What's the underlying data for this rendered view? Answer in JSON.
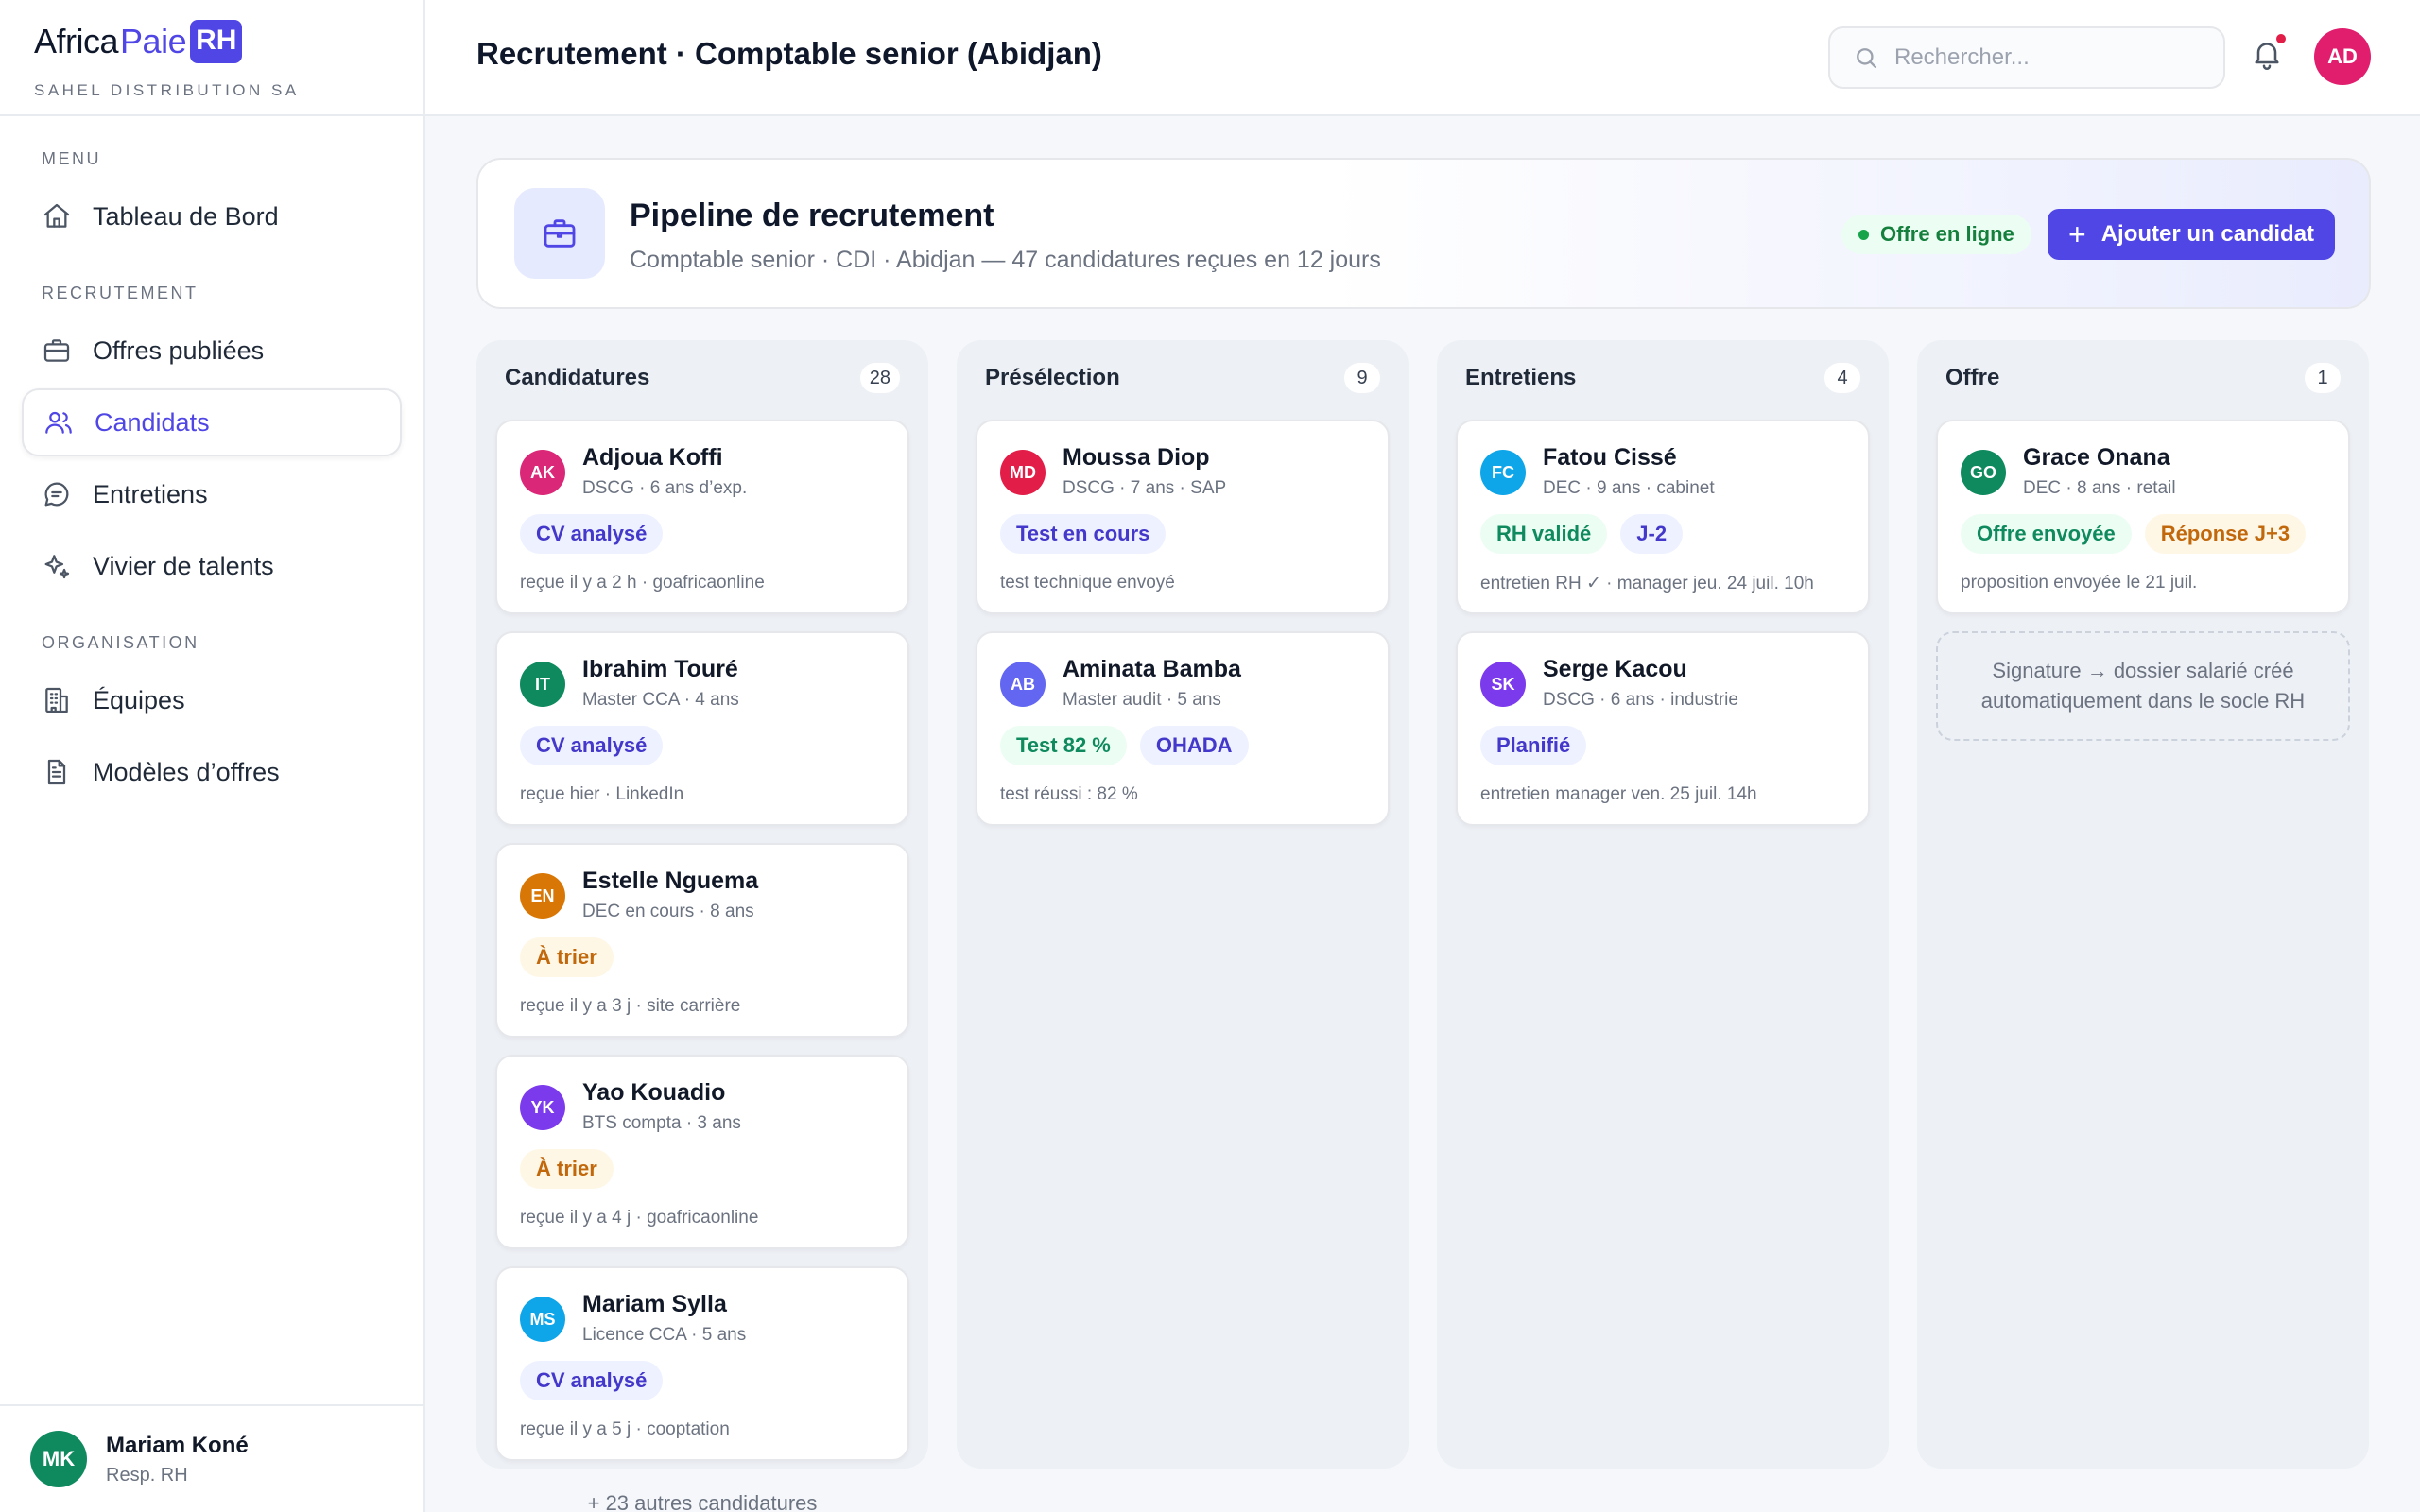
{
  "brand": {
    "name_part1": "Africa",
    "name_part2": "Paie",
    "name_part3": "RH",
    "company": "SAHEL DISTRIBUTION SA"
  },
  "nav": {
    "menu_label": "MENU",
    "dashboard": "Tableau de Bord",
    "recruitment_label": "RECRUTEMENT",
    "offers": "Offres publiées",
    "candidates": "Candidats",
    "interviews": "Entretiens",
    "talent_pool": "Vivier de talents",
    "organisation_label": "ORGANISATION",
    "teams": "Équipes",
    "offer_templates": "Modèles d’offres"
  },
  "user": {
    "initials": "MK",
    "name": "Mariam Koné",
    "role": "Resp. RH"
  },
  "header": {
    "title": "Recrutement · Comptable senior (Abidjan)",
    "search_placeholder": "Rechercher...",
    "avatar_initials": "AD"
  },
  "banner": {
    "title": "Pipeline de recrutement",
    "subtitle": "Comptable senior · CDI · Abidjan — 47 candidatures reçues en 12 jours",
    "status": "Offre en ligne",
    "add_button": "Ajouter un candidat"
  },
  "colors": {
    "accent": "#4f46e5",
    "green": "#0f8a5f",
    "amber": "#c2680c"
  },
  "columns": [
    {
      "title": "Candidatures",
      "count": "28",
      "more": "+ 23 autres candidatures",
      "cards": [
        {
          "initials": "AK",
          "color": "#db2777",
          "name": "Adjoua Koffi",
          "meta": "DSCG · 6 ans d’exp.",
          "tags": [
            "CV analysé"
          ],
          "foot": "reçue il y a 2 h · goafricaonline"
        },
        {
          "initials": "IT",
          "color": "#0f8a5f",
          "name": "Ibrahim Touré",
          "meta": "Master CCA · 4 ans",
          "tags": [
            "CV analysé"
          ],
          "foot": "reçue hier · LinkedIn"
        },
        {
          "initials": "EN",
          "color": "#d97706",
          "name": "Estelle Nguema",
          "meta": "DEC en cours · 8 ans",
          "tags": [
            "À trier"
          ],
          "foot": "reçue il y a 3 j · site carrière"
        },
        {
          "initials": "YK",
          "color": "#7c3aed",
          "name": "Yao Kouadio",
          "meta": "BTS compta · 3 ans",
          "tags": [
            "À trier"
          ],
          "foot": "reçue il y a 4 j · goafricaonline"
        },
        {
          "initials": "MS",
          "color": "#0ea5e9",
          "name": "Mariam Sylla",
          "meta": "Licence CCA · 5 ans",
          "tags": [
            "CV analysé"
          ],
          "foot": "reçue il y a 5 j · cooptation"
        }
      ]
    },
    {
      "title": "Présélection",
      "count": "9",
      "cards": [
        {
          "initials": "MD",
          "color": "#e11d48",
          "name": "Moussa Diop",
          "meta": "DSCG · 7 ans · SAP",
          "tags": [
            "Test en cours"
          ],
          "foot": "test technique envoyé"
        },
        {
          "initials": "AB",
          "color": "#6366f1",
          "name": "Aminata Bamba",
          "meta": "Master audit · 5 ans",
          "tags": [
            "Test 82 %",
            "OHADA"
          ],
          "foot": "test réussi : 82 %"
        }
      ]
    },
    {
      "title": "Entretiens",
      "count": "4",
      "cards": [
        {
          "initials": "FC",
          "color": "#0ea5e9",
          "name": "Fatou Cissé",
          "meta": "DEC · 9 ans · cabinet",
          "tags": [
            "RH validé",
            "J-2"
          ],
          "foot": "entretien RH ✓ · manager jeu. 24 juil. 10h"
        },
        {
          "initials": "SK",
          "color": "#7c3aed",
          "name": "Serge Kacou",
          "meta": "DSCG · 6 ans · industrie",
          "tags": [
            "Planifié"
          ],
          "foot": "entretien manager ven. 25 juil. 14h"
        }
      ]
    },
    {
      "title": "Offre",
      "count": "1",
      "cards": [
        {
          "initials": "GO",
          "color": "#0f8a5f",
          "name": "Grace Onana",
          "meta": "DEC · 8 ans · retail",
          "tags": [
            "Offre envoyée",
            "Réponse J+3"
          ],
          "foot": "proposition envoyée le 21 juil."
        }
      ],
      "note": "Signature → dossier salarié créé automatiquement dans le socle RH"
    }
  ]
}
